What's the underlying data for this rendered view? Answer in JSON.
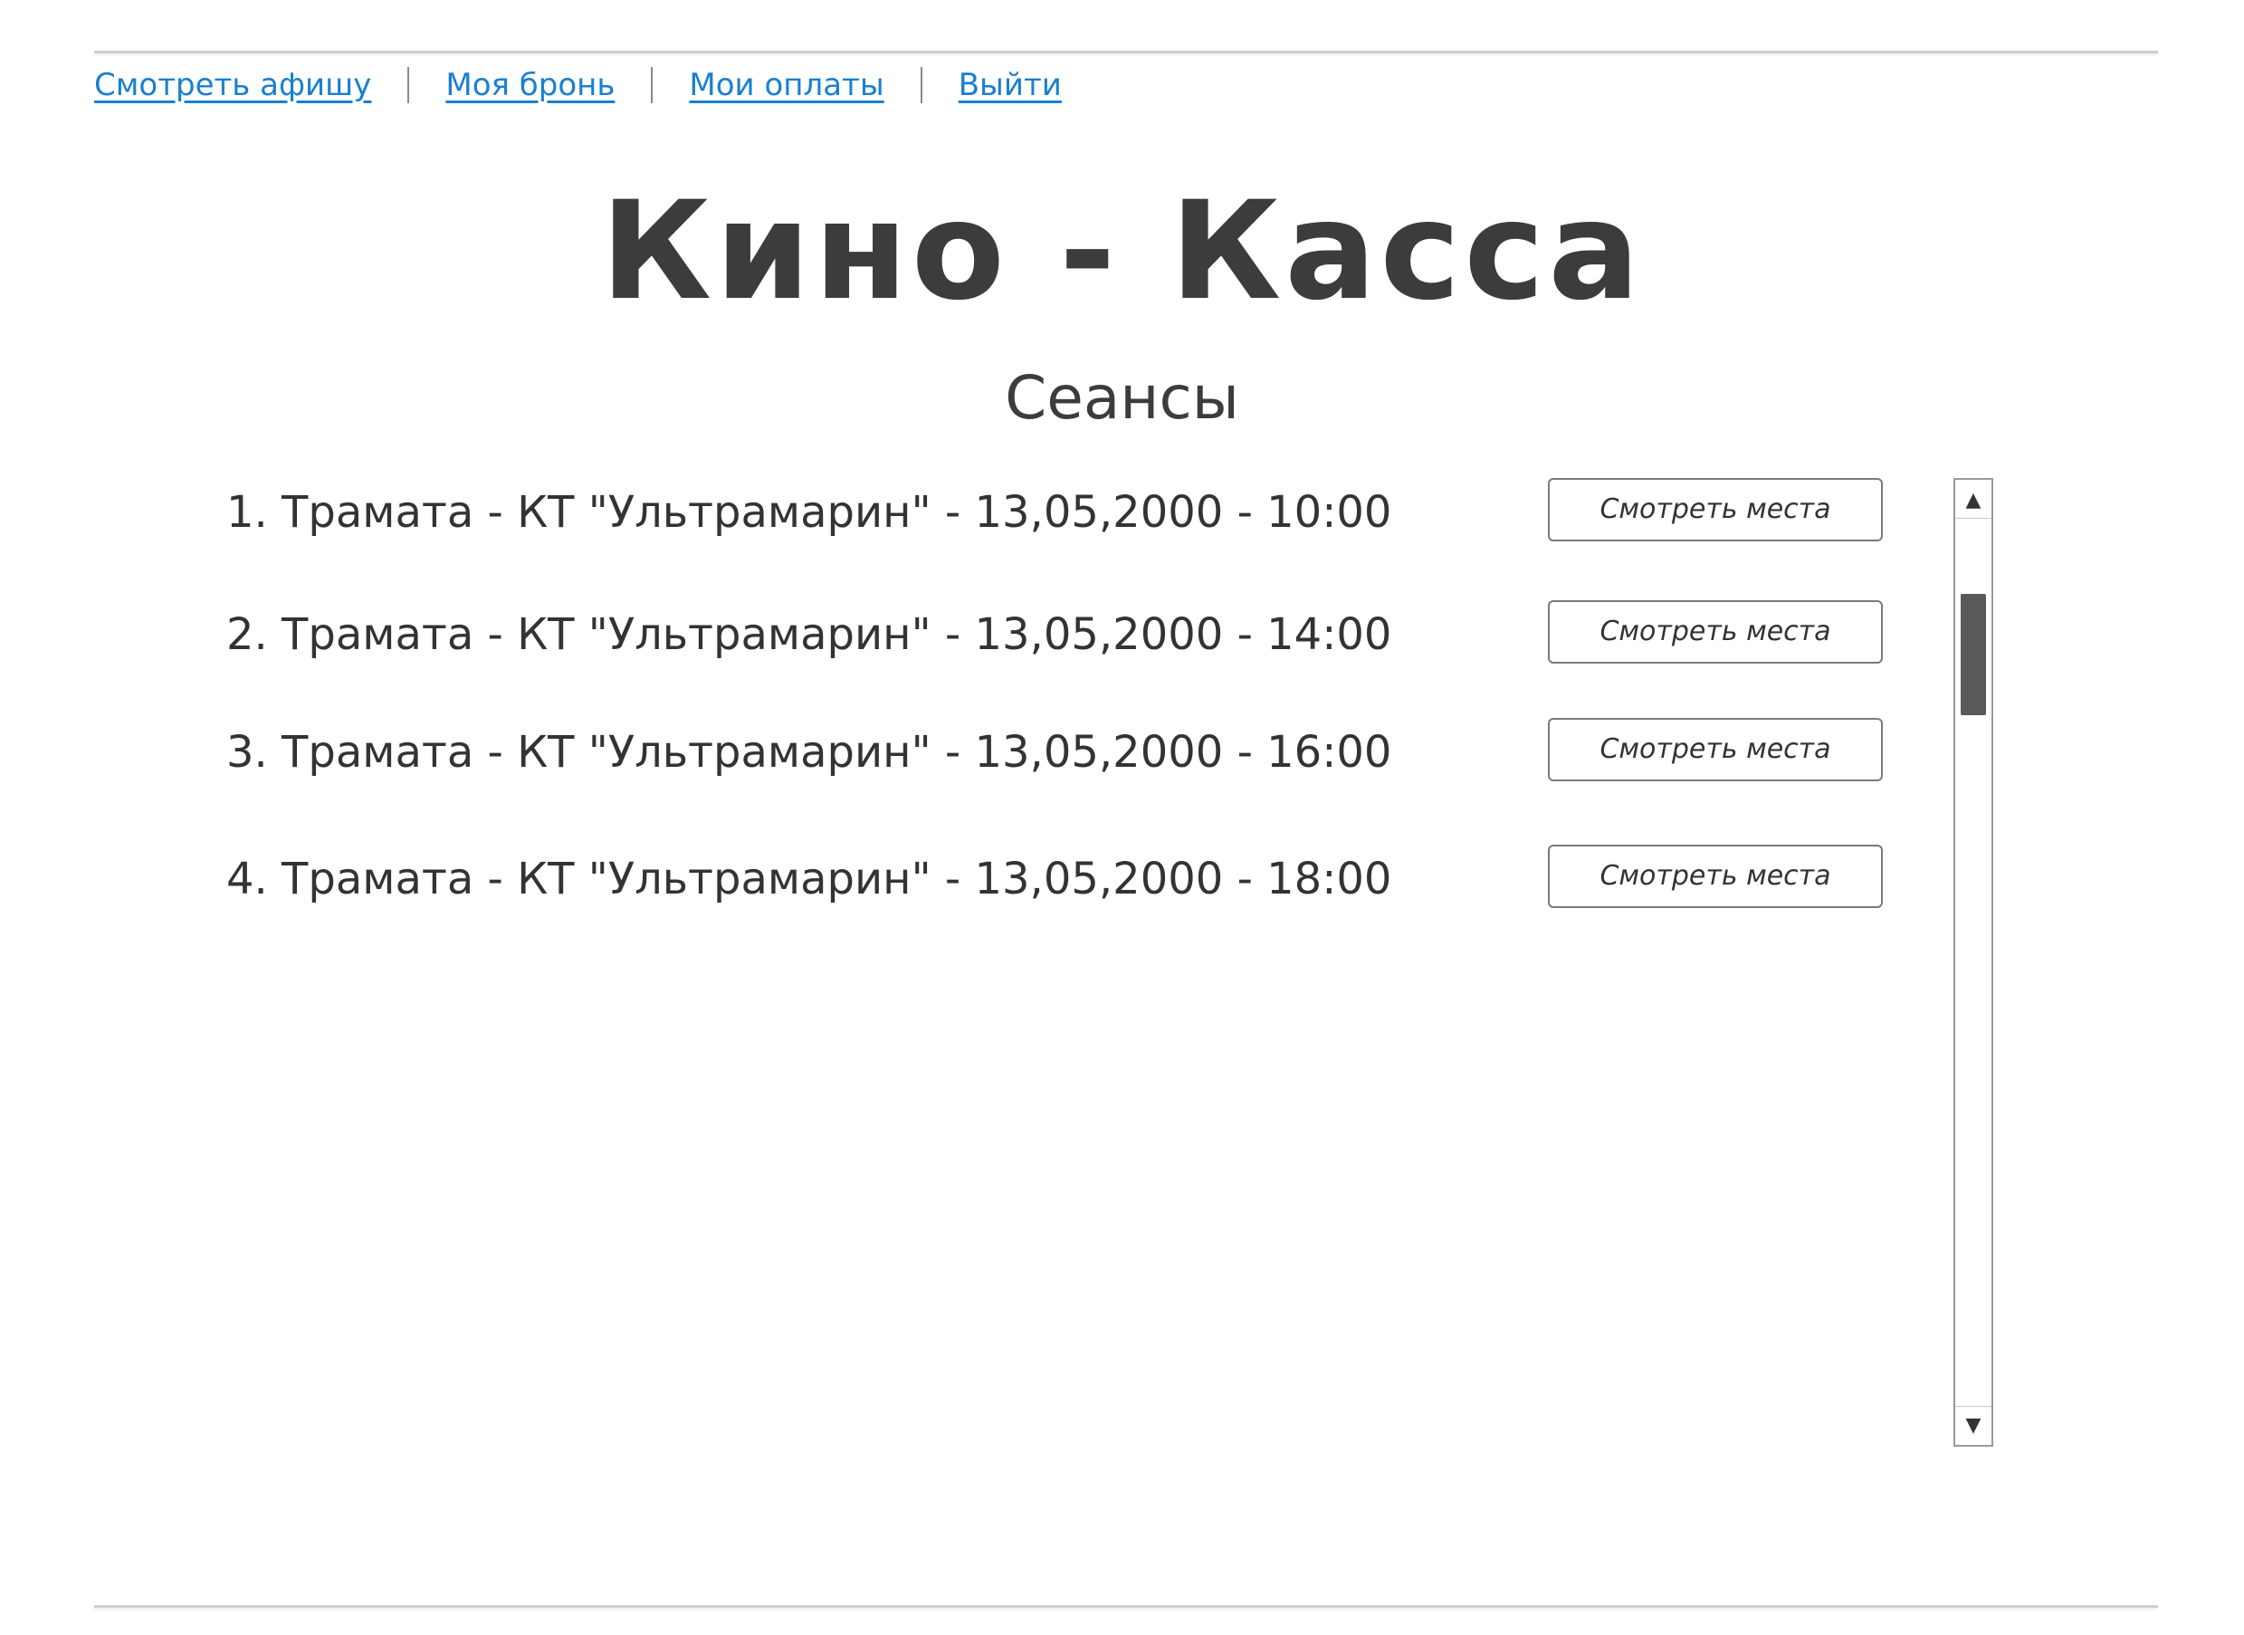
{
  "nav": {
    "items": [
      {
        "label": "Смотреть афишу"
      },
      {
        "label": "Моя бронь"
      },
      {
        "label": "Мои оплаты"
      },
      {
        "label": "Выйти"
      }
    ],
    "separator": "|"
  },
  "page": {
    "title": "Кино - Касса",
    "subtitle": "Сеансы"
  },
  "sessions": [
    {
      "text": "1. Трамата - КТ \"Ультрамарин\" - 13,05,2000 - 10:00",
      "button": "Смотреть места"
    },
    {
      "text": "2. Трамата - КТ \"Ультрамарин\" - 13,05,2000 - 14:00",
      "button": "Смотреть места"
    },
    {
      "text": "3. Трамата - КТ \"Ультрамарин\" - 13,05,2000 - 16:00",
      "button": "Смотреть места"
    },
    {
      "text": "4. Трамата - КТ \"Ультрамарин\" - 13,05,2000 - 18:00",
      "button": "Смотреть места"
    }
  ],
  "scrollbar": {
    "up_icon": "▲",
    "down_icon": "▼"
  },
  "colors": {
    "link": "#1a7fd1",
    "text": "#333333",
    "scroll_thumb": "#595959"
  }
}
